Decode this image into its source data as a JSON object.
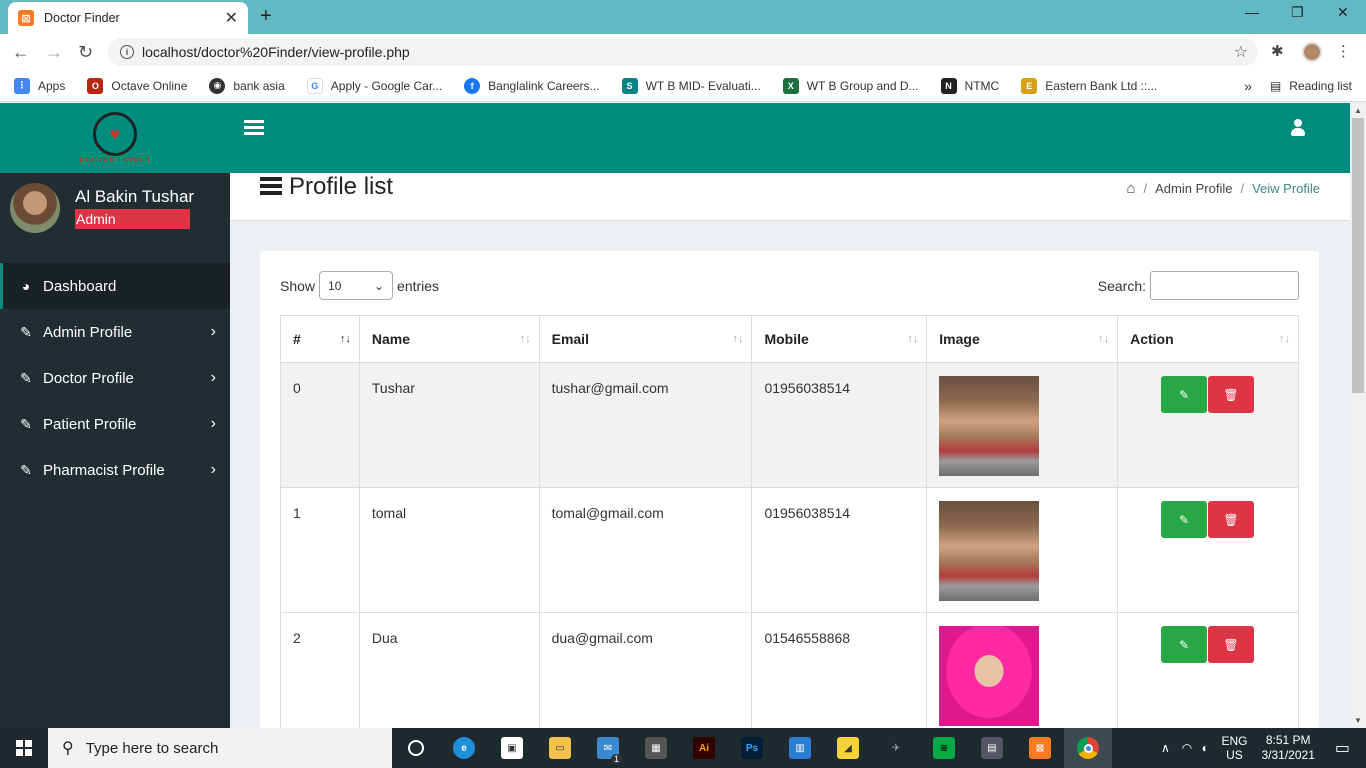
{
  "browser": {
    "tab_title": "Doctor Finder",
    "tab_favicon": "XAMPP",
    "url": "localhost/doctor%20Finder/view-profile.php",
    "bookmarks": [
      {
        "label": "Apps",
        "color": "#4285f4"
      },
      {
        "label": "Octave Online",
        "color": "#b6280f"
      },
      {
        "label": "bank asia",
        "color": "#333333"
      },
      {
        "label": "Apply - Google Car...",
        "color": "#4285f4"
      },
      {
        "label": "Banglalink Careers...",
        "color": "#1877f2"
      },
      {
        "label": "WT B MID- Evaluati...",
        "color": "#038387"
      },
      {
        "label": "WT B Group and D...",
        "color": "#1d6f42"
      },
      {
        "label": "NTMC",
        "color": "#222222"
      },
      {
        "label": "Eastern Bank Ltd ::...",
        "color": "#d4a017"
      }
    ],
    "reading_list": "Reading list",
    "more": "»"
  },
  "sidebar": {
    "logo_text": "DOCTOR FINDER",
    "user_name": "Al Bakin Tushar",
    "user_role": "Admin",
    "items": [
      {
        "label": "Dashboard",
        "icon": "dashboard-icon"
      },
      {
        "label": "Admin Profile",
        "icon": "edit-icon"
      },
      {
        "label": "Doctor Profile",
        "icon": "edit-icon"
      },
      {
        "label": "Patient Profile",
        "icon": "edit-icon"
      },
      {
        "label": "Pharmacist Profile",
        "icon": "edit-icon"
      }
    ]
  },
  "header": {
    "title": "Profile list",
    "breadcrumb": [
      "Admin Profile",
      "Veiw Profile"
    ]
  },
  "table_controls": {
    "show_label": "Show",
    "entries_value": "10",
    "entries_label": "entries",
    "search_label": "Search:"
  },
  "table": {
    "columns": [
      "#",
      "Name",
      "Email",
      "Mobile",
      "Image",
      "Action"
    ],
    "rows": [
      {
        "id": "0",
        "name": "Tushar",
        "email": "tushar@gmail.com",
        "mobile": "01956038514"
      },
      {
        "id": "1",
        "name": "tomal",
        "email": "tomal@gmail.com",
        "mobile": "01956038514"
      },
      {
        "id": "2",
        "name": "Dua",
        "email": "dua@gmail.com",
        "mobile": "01546558868"
      }
    ]
  },
  "taskbar": {
    "search_placeholder": "Type here to search",
    "lang_top": "ENG",
    "lang_bottom": "US",
    "time": "8:51 PM",
    "date": "3/31/2021",
    "mail_badge": "1"
  },
  "colors": {
    "teal": "#008d7e",
    "sidebar": "#222d32",
    "role_badge": "#dd3545",
    "edit": "#28a745",
    "delete": "#dc3545"
  }
}
